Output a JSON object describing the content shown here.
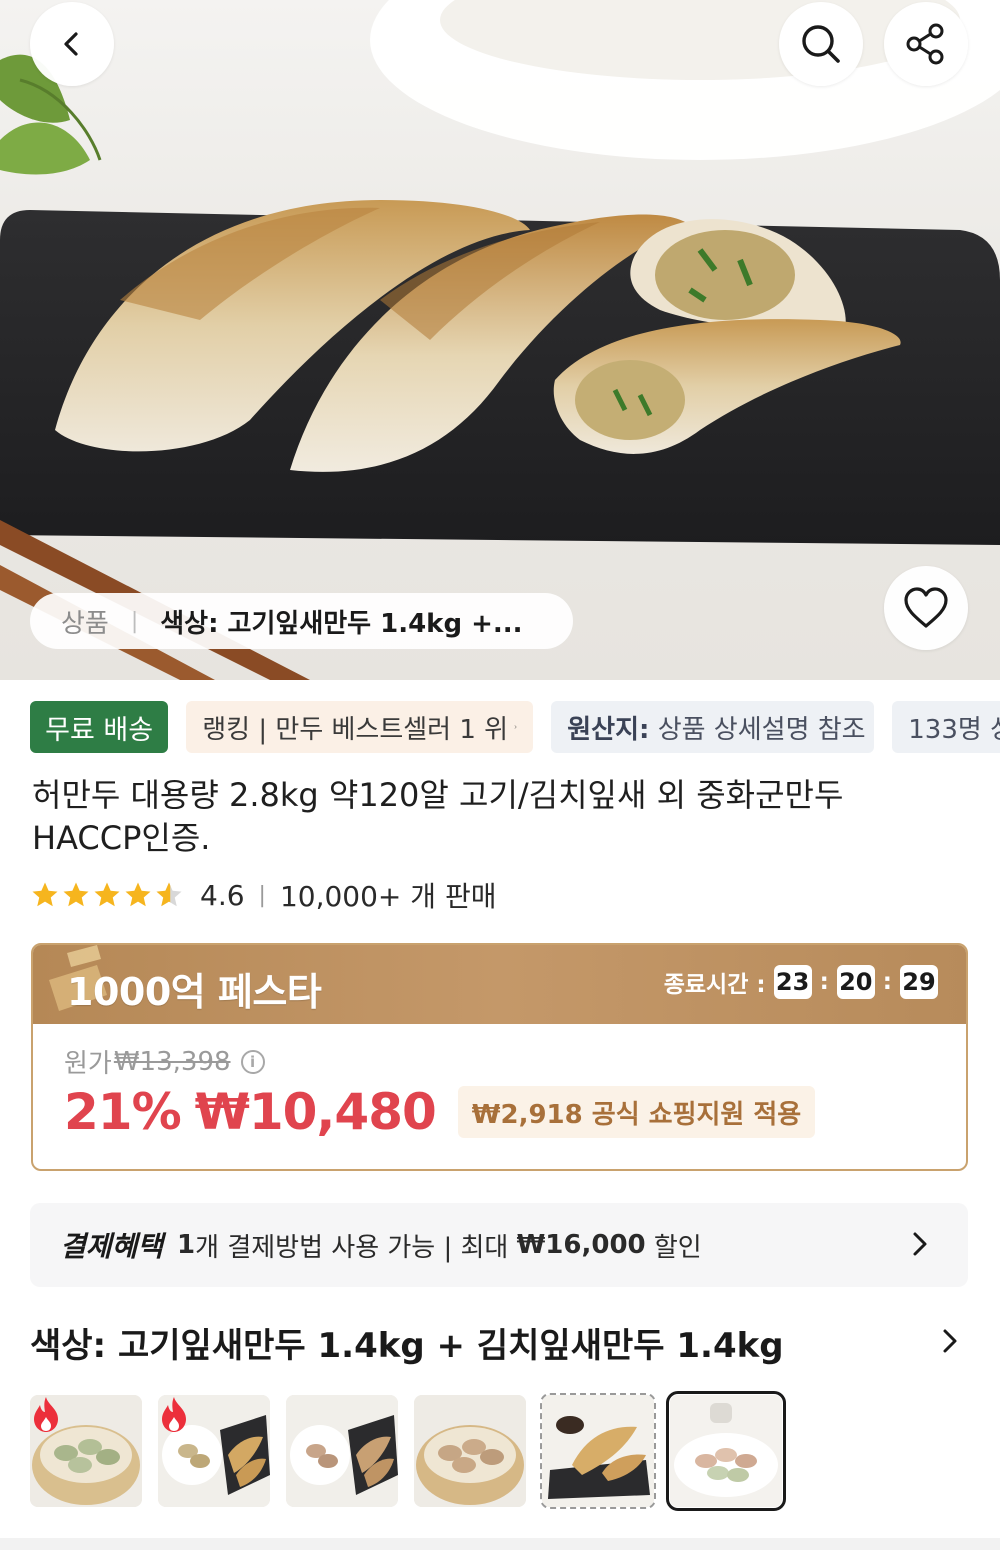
{
  "hero": {
    "variant_pill": {
      "category": "상품",
      "separator": "|",
      "value": "색상: 고기잎새만두 1.4kg +..."
    },
    "icons": [
      "back-icon",
      "search-icon",
      "share-icon",
      "heart-icon"
    ]
  },
  "tags": {
    "free_shipping": "무료 배송",
    "ranking": "랭킹 | 만두 베스트셀러 1 위",
    "origin_label": "원산지:",
    "origin_value": " 상품 상세설명 참조",
    "buyers": "133명 상"
  },
  "product": {
    "title": "허만두 대용량 2.8kg 약120알 고기/김치잎새 외 중화군만두 HACCP인증.",
    "rating": "4.6",
    "rating_stars": 4.6,
    "sep": "|",
    "sales": "10,000+ 개 판매"
  },
  "promo": {
    "title": "1000억 페스타",
    "timer_label": "종료시간 :",
    "timer": {
      "hours": "23",
      "minutes": "20",
      "seconds": "29"
    },
    "original_label": "원가",
    "original_price": "₩13,398",
    "discount": "21%",
    "price": "₩10,480",
    "support": "₩2,918 공식 쇼핑지원 적용"
  },
  "payment": {
    "title": "결제혜택",
    "count": "1",
    "text": "개 결제방법 사용 가능 | 최대 ",
    "max": "₩16,000",
    "suffix": " 할인"
  },
  "options": {
    "title": "색상: 고기잎새만두 1.4kg + 김치잎새만두 1.4kg",
    "thumbnails": [
      {
        "name": "steamer-dumplings",
        "hot": true
      },
      {
        "name": "dumplings-on-slate",
        "hot": true
      },
      {
        "name": "round-plate-dumplings",
        "hot": false
      },
      {
        "name": "steamer-basket-dumplings",
        "hot": false
      },
      {
        "name": "fried-dumplings",
        "hot": false
      },
      {
        "name": "plated-dumplings",
        "hot": false,
        "selected": true
      }
    ]
  },
  "colors": {
    "accent_red": "#e0444e",
    "free_green": "#2e7d45",
    "promo_gold": "#c49869"
  }
}
